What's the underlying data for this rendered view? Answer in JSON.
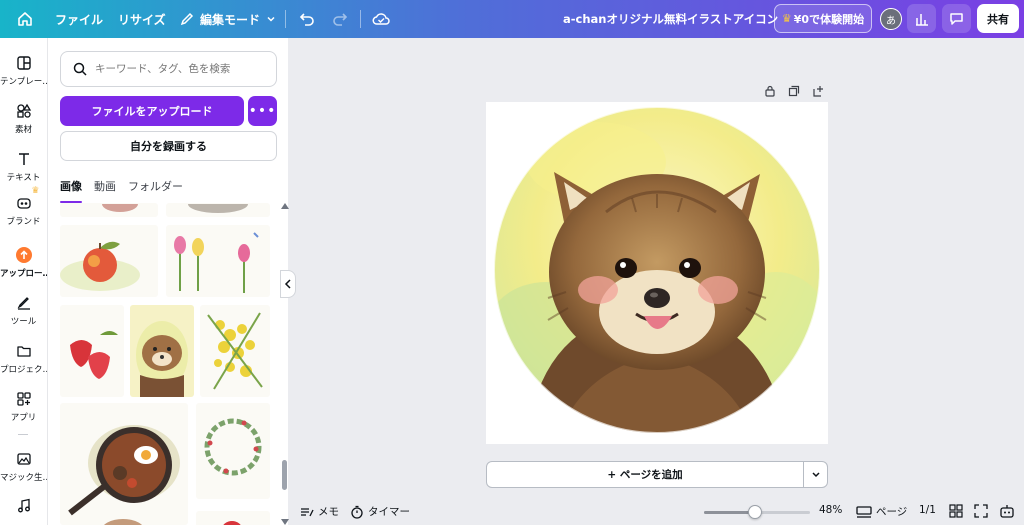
{
  "topbar": {
    "menu_file": "ファイル",
    "menu_resize": "リサイズ",
    "edit_mode": "編集モード",
    "doc_title": "a-chanオリジナル無料イラストアイコン",
    "trial_label": "¥0で体験開始",
    "avatar_initial": "あ",
    "share_label": "共有"
  },
  "rail": {
    "items": [
      {
        "label": "テンプレー…",
        "icon": "template-icon"
      },
      {
        "label": "素材",
        "icon": "elements-icon"
      },
      {
        "label": "テキスト",
        "icon": "text-icon"
      },
      {
        "label": "ブランド",
        "icon": "brand-icon"
      },
      {
        "label": "アップロー…",
        "icon": "upload-cloud-icon"
      },
      {
        "label": "ツール",
        "icon": "draw-tool-icon"
      },
      {
        "label": "プロジェク…",
        "icon": "folder-icon"
      },
      {
        "label": "アプリ",
        "icon": "apps-icon"
      },
      {
        "label": "マジック生…",
        "icon": "magic-media-icon"
      },
      {
        "label": "",
        "icon": "audio-icon"
      }
    ]
  },
  "panel": {
    "search_placeholder": "キーワード、タグ、色を検索",
    "upload_button": "ファイルをアップロード",
    "more_button": "•••",
    "record_button": "自分を録画する",
    "tabs": [
      "画像",
      "動画",
      "フォルダー"
    ]
  },
  "canvas": {
    "add_page": "+ ページを追加"
  },
  "bottombar": {
    "notes": "メモ",
    "timer": "タイマー",
    "zoom_value": 0.48,
    "zoom_label": "48%",
    "pages_label": "ページ",
    "page_count": "1/1"
  },
  "colors": {
    "accent": "#7d2ae8",
    "topbar_start": "#18b4c9",
    "topbar_end": "#7a3fe4"
  }
}
